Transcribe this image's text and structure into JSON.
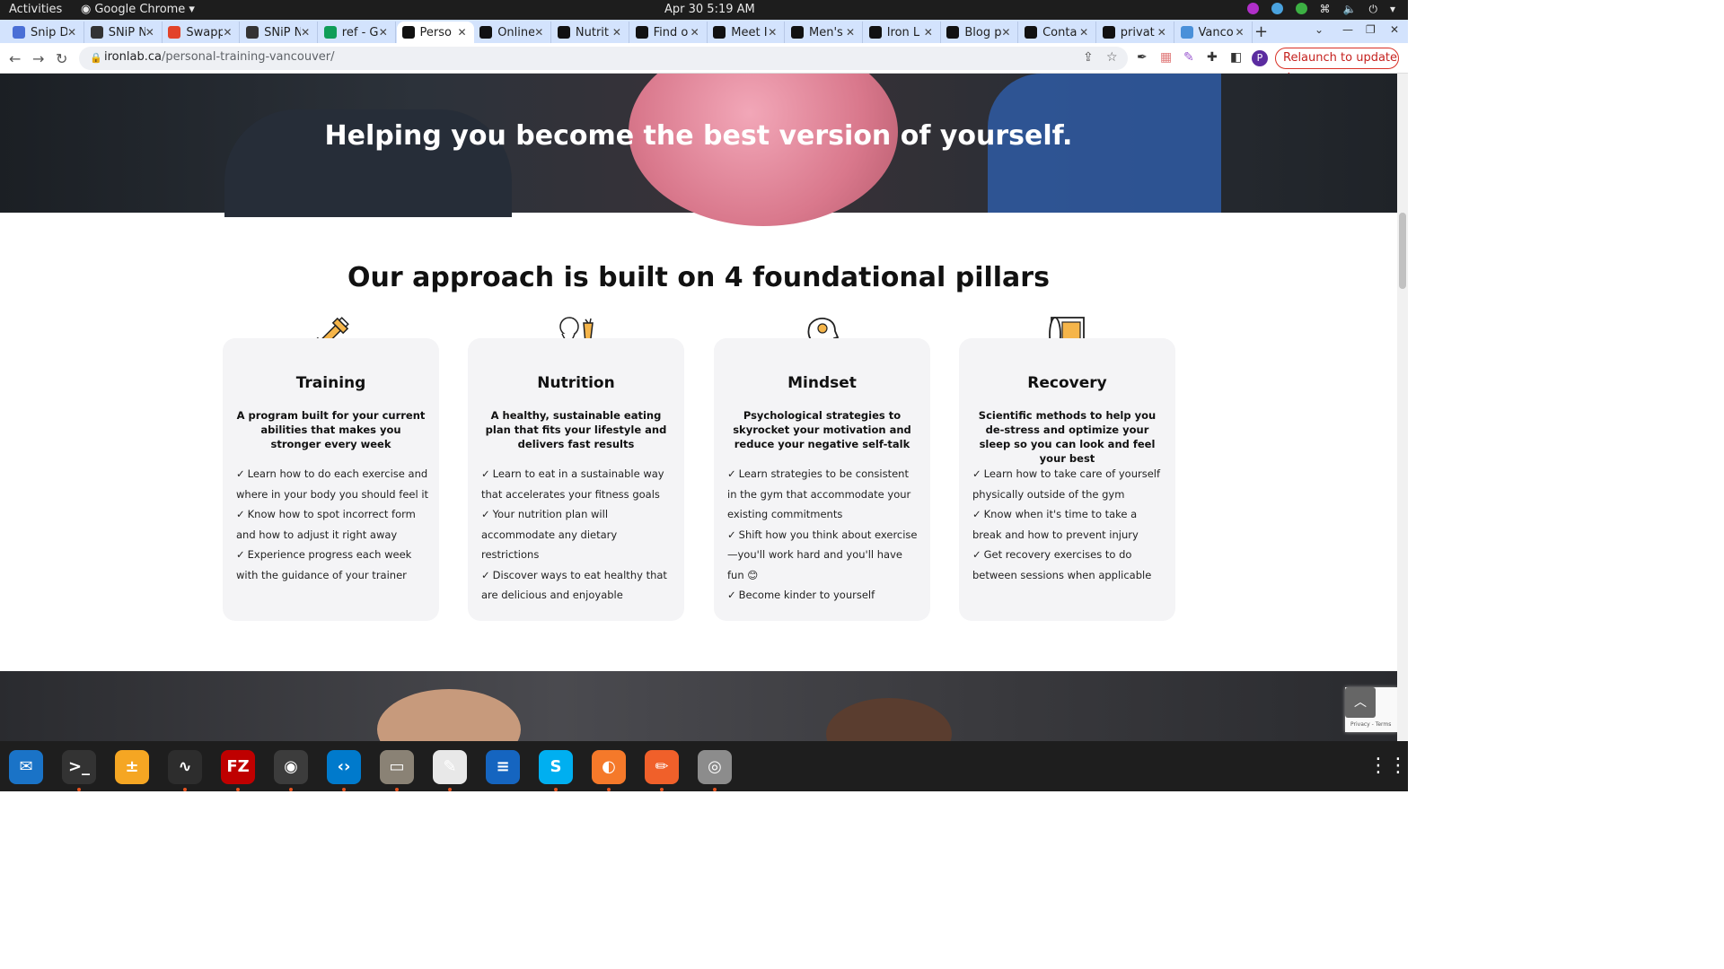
{
  "topbar": {
    "activities": "Activities",
    "app_name": "Google Chrome",
    "clock": "Apr 30  5:19 AM"
  },
  "tabs": [
    {
      "title": "Snip D",
      "color": "#4a6fd6"
    },
    {
      "title": "SNiP N",
      "color": "#333333"
    },
    {
      "title": "Swapp",
      "color": "#e24329"
    },
    {
      "title": "SNiP N",
      "color": "#333333"
    },
    {
      "title": "ref - G",
      "color": "#0f9d58"
    },
    {
      "title": "Perso",
      "color": "#111111"
    },
    {
      "title": "Online",
      "color": "#111111"
    },
    {
      "title": "Nutrit",
      "color": "#111111"
    },
    {
      "title": "Find o",
      "color": "#111111"
    },
    {
      "title": "Meet I",
      "color": "#111111"
    },
    {
      "title": "Men's",
      "color": "#111111"
    },
    {
      "title": "Iron L",
      "color": "#111111"
    },
    {
      "title": "Blog p",
      "color": "#111111"
    },
    {
      "title": "Conta",
      "color": "#111111"
    },
    {
      "title": "privat",
      "color": "#111111"
    },
    {
      "title": "Vanco",
      "color": "#4a90d9"
    }
  ],
  "active_tab_index": 5,
  "address": {
    "domain": "ironlab.ca",
    "path": "/personal-training-vancouver/"
  },
  "relaunch_label": "Relaunch to update",
  "avatar_letter": "P",
  "hero": {
    "heading": "Helping you become the best version of yourself."
  },
  "pillars": {
    "title": "Our approach is built on 4 foundational pillars",
    "cards": [
      {
        "name": "Training",
        "icon": "dumbbell-icon",
        "subtitle": "A program built for your current abilities that makes you stronger every week",
        "points": [
          "Learn how to do each exercise and where in your body you should feel it",
          "Know how to spot incorrect form and how to adjust it right away",
          "Experience progress each week with the guidance of your trainer"
        ]
      },
      {
        "name": "Nutrition",
        "icon": "food-icon",
        "subtitle": "A healthy, sustainable eating plan that fits your lifestyle and delivers fast results",
        "points": [
          "Learn to eat in a sustainable way that accelerates your fitness goals",
          "Your nutrition plan will accommodate any dietary restrictions",
          "Discover ways to eat healthy that are delicious and enjoyable"
        ]
      },
      {
        "name": "Mindset",
        "icon": "head-brain-icon",
        "subtitle": "Psychological strategies to skyrocket your motivation and reduce your negative self-talk",
        "points": [
          "Learn strategies to be consistent in the gym that accommodate your existing commitments",
          "Shift how you think about exercise—you'll work hard and you'll have fun 😊",
          "Become kinder to yourself"
        ]
      },
      {
        "name": "Recovery",
        "icon": "foam-roller-mat-icon",
        "subtitle": "Scientific methods to help you de-stress and optimize your sleep so you can look and feel your best",
        "points": [
          "Learn how to take care of yourself physically outside of the gym",
          "Know when it's time to take a break and how to prevent injury",
          "Get recovery exercises to do between sessions when applicable"
        ]
      }
    ]
  },
  "check_glyph": "✓",
  "recaptcha_text": "Privacy - Terms",
  "dock": [
    {
      "name": "thunderbird-icon",
      "glyph": "✉",
      "bg": "#1a73c7",
      "running": false
    },
    {
      "name": "terminal-icon",
      "glyph": ">_",
      "bg": "#333333",
      "running": true
    },
    {
      "name": "calculator-icon",
      "glyph": "±",
      "bg": "#f5a623",
      "running": false
    },
    {
      "name": "system-monitor-icon",
      "glyph": "∿",
      "bg": "#2d2d2d",
      "running": true
    },
    {
      "name": "filezilla-icon",
      "glyph": "FZ",
      "bg": "#bf0000",
      "running": true
    },
    {
      "name": "chrome-icon",
      "glyph": "◉",
      "bg": "#3c3c3c",
      "running": true
    },
    {
      "name": "vscode-icon",
      "glyph": "‹›",
      "bg": "#007acc",
      "running": true
    },
    {
      "name": "files-icon",
      "glyph": "▭",
      "bg": "#8a8275",
      "running": true
    },
    {
      "name": "text-editor-icon",
      "glyph": "✎",
      "bg": "#e8e8e8",
      "running": true
    },
    {
      "name": "writer-icon",
      "glyph": "≡",
      "bg": "#1565c0",
      "running": false
    },
    {
      "name": "skype-icon",
      "glyph": "S",
      "bg": "#00aff0",
      "running": true
    },
    {
      "name": "blender-icon",
      "glyph": "◐",
      "bg": "#f5792a",
      "running": true
    },
    {
      "name": "inkscape-icon",
      "glyph": "✏",
      "bg": "#f0602a",
      "running": true
    },
    {
      "name": "disk-icon",
      "glyph": "◎",
      "bg": "#8c8c8c",
      "running": true
    }
  ]
}
